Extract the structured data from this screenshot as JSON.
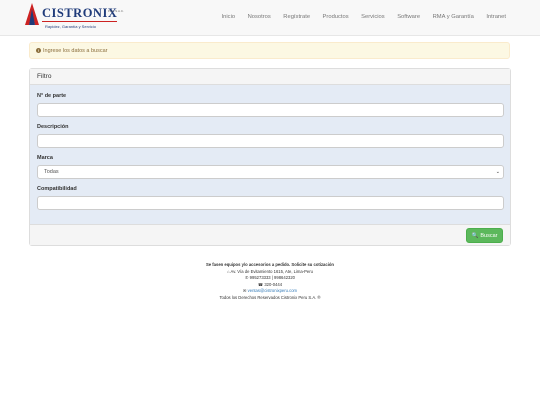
{
  "brand": {
    "name": "CISTRONIX",
    "tm": "Peru S.A.C.",
    "tagline": "Rapidez, Garantía y Servicio",
    "colors": {
      "primary": "#1f3b7a",
      "accent": "#cc2222"
    }
  },
  "nav": {
    "items": [
      "Inicio",
      "Nosotros",
      "Regístrate",
      "Productos",
      "Servicios",
      "Software",
      "RMA y Garantía",
      "Intranet"
    ]
  },
  "alert": {
    "icon": "exclamation-circle-icon",
    "text": "Ingrese los datos a buscar",
    "colors": {
      "background": "#fcf8e3",
      "text": "#8a6d3b"
    }
  },
  "filter": {
    "title": "Filtro",
    "part_number_label": "N° de parte",
    "part_number_value": "",
    "description_label": "Descripción",
    "description_value": "",
    "brand_label": "Marca",
    "brand_selected": "Todas",
    "compatibility_label": "Compatibilidad",
    "compatibility_value": "",
    "search_button": "Buscar",
    "search_icon": "search-icon",
    "colors": {
      "body": "#e4ebf5",
      "button": "#5cb85c"
    }
  },
  "footer": {
    "notice": "Se fasen equipos y/o accesorios a pedido. Solicite su cotización",
    "address": "Av. Vía de Evitamiento 1615, Ate, Lima-Peru",
    "phones": "995273333 | 998642320",
    "landline": "320-0444",
    "email": "ventas@cistronixperu.com",
    "copyright": "Todos los Derechos Reservados Cistronix Peru S.A. ®"
  }
}
